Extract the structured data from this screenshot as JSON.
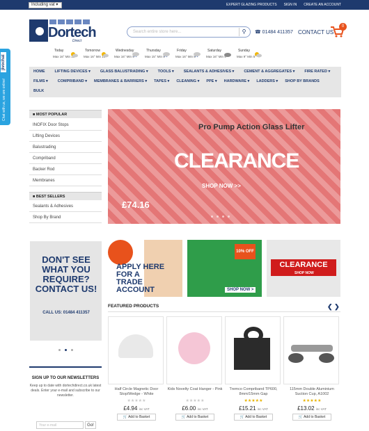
{
  "topbar": {
    "vat_select": "Including vat",
    "links": [
      "EXPERT GLAZING PRODUCTS",
      "SIGN IN",
      "CREATE AN ACCOUNT"
    ]
  },
  "header": {
    "logo_text": "Dortech",
    "logo_sub": "Direct",
    "search_placeholder": "Search entire store here...",
    "phone": "01484 411357",
    "contact": "CONTACT US",
    "cart_count": "0"
  },
  "weather": [
    {
      "day": "Today",
      "temps": "Max 16° Min 10°"
    },
    {
      "day": "Tomorrow",
      "temps": "Max 16° Min 10°"
    },
    {
      "day": "Wednesday",
      "temps": "Max 16° Min 9°"
    },
    {
      "day": "Thursday",
      "temps": "Max 15° Min 9°"
    },
    {
      "day": "Friday",
      "temps": "Max 16° Min 8°"
    },
    {
      "day": "Saturday",
      "temps": "Max 16° Min 9°"
    },
    {
      "day": "Sunday",
      "temps": "Max 9° Min 5°"
    }
  ],
  "nav": {
    "row1": [
      "HOME",
      "LIFTING DEVICES ▾",
      "GLASS BALUSTRADING ▾",
      "TOOLS ▾",
      "SEALANTS & ADHESIVES ▾",
      "CEMENT & AGGREGATES ▾",
      "FIRE RATED ▾"
    ],
    "row2": [
      "FILMS ▾",
      "COMPRIBAND ▾",
      "MEMBRANES & BARRIERS ▾",
      "TAPES ▾",
      "CLEANING ▾",
      "PPE ▾",
      "HARDWARE ▾",
      "LADDERS ▾",
      "SHOP BY BRANDS"
    ],
    "row3": [
      "BULK"
    ]
  },
  "sidebar": {
    "popular_title": "MOST POPULAR",
    "popular": [
      "INOFIX Door Stops",
      "Lifting Devices",
      "Balustrading",
      "Compriband",
      "Backer Rod",
      "Membranes"
    ],
    "bestsellers_title": "BEST SELLERS",
    "bestsellers": [
      "Sealants & Adhesives",
      "Shop By Brand"
    ]
  },
  "banner": {
    "word": "CLEARANCE",
    "shop": "SHOP NOW >>",
    "title": "Pro Pump Action Glass Lifter",
    "price": "£74.16"
  },
  "promos": [
    {
      "text": "DON'T SEE WHAT YOU REQUIRE? CONTACT US!",
      "sub": "CALL US: 01484 411357"
    },
    {
      "text": "APPLY HERE FOR A TRADE ACCOUNT"
    },
    {
      "text": "10% OFF",
      "sub": "SHOP NOW >"
    },
    {
      "text": "CLEARANCE",
      "sub": "SHOP NOW"
    }
  ],
  "featured": {
    "title": "FEATURED PRODUCTS",
    "products": [
      {
        "name": "Half Circle Magnetic Door Stop/Wedge - White",
        "price": "£4.94",
        "vat": "inc VAT",
        "basket": "Add to Basket"
      },
      {
        "name": "Kids Novelty Coat Hanger - Pink",
        "price": "£6.00",
        "vat": "inc VAT",
        "basket": "Add to Basket"
      },
      {
        "name": "Tremco Compriband TP600, 8mm/15mm Gap",
        "price": "£15.21",
        "vat": "inc VAT",
        "basket": "Add to Basket"
      },
      {
        "name": "115mm Double Aluminium Suction Cup, A1002",
        "price": "£13.02",
        "vat": "inc VAT",
        "basket": "Add to Basket"
      }
    ]
  },
  "newsletter": {
    "title": "SIGN UP TO OUR NEWSLETTERS",
    "body": "Keep up to date with dortechdirect.co.uk latest deals. Enter your e-mail and subscribe to our newsletter.",
    "placeholder": "Your e-mail",
    "go": "Go!"
  },
  "chat": {
    "label": "Chat with us, we are online!",
    "brand": "jivochat"
  },
  "colors": {
    "brand": "#1e3a6e",
    "accent": "#e8521c",
    "banner": "#e58a8a"
  }
}
